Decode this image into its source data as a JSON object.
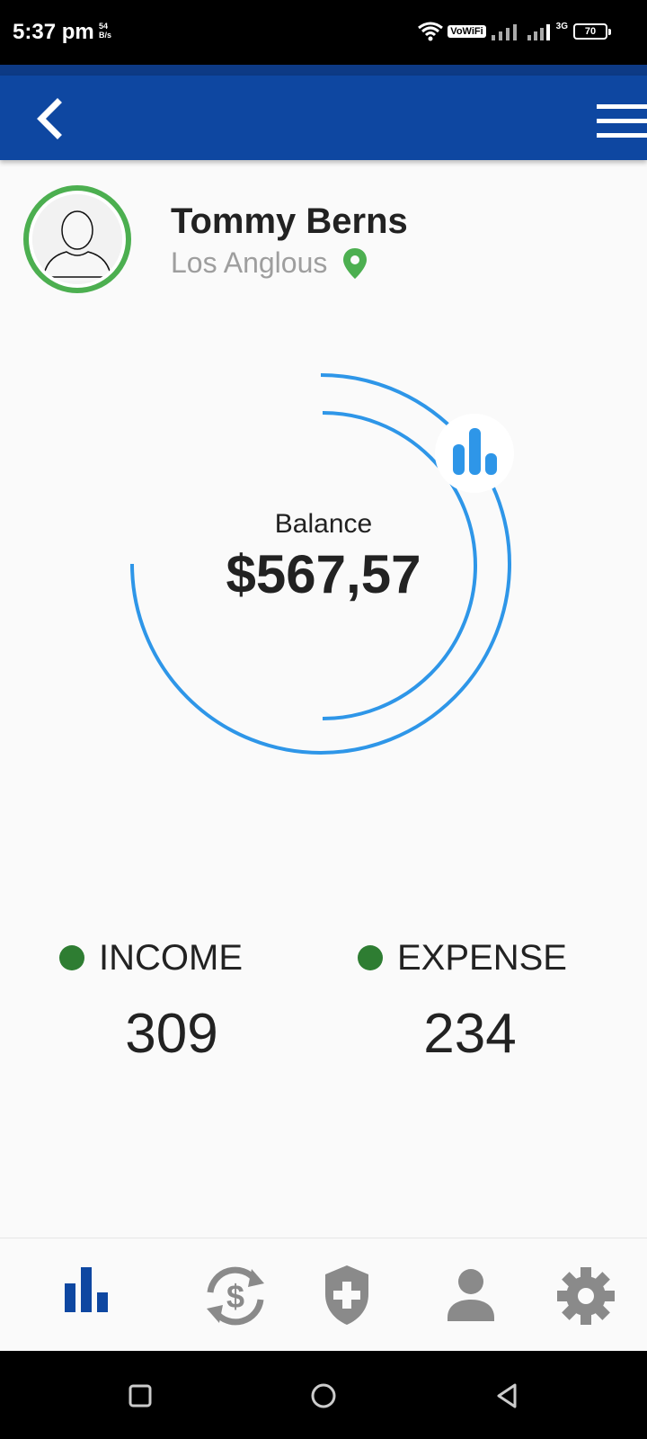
{
  "status_bar": {
    "time": "5:37 pm",
    "speed_value": "54",
    "speed_unit": "B/s",
    "vowifi": "VoWiFi",
    "network": "3G",
    "battery": "70"
  },
  "app_bar": {
    "back_icon": "chevron-left-icon",
    "menu_icon": "hamburger-menu-icon",
    "color": "#0e47a1"
  },
  "profile": {
    "name": "Tommy Berns",
    "location": "Los Anglous",
    "avatar_ring_color": "#4caf50"
  },
  "balance": {
    "label": "Balance",
    "value": "$567,57",
    "ring_color": "#2e96e8"
  },
  "stats": {
    "income": {
      "label": "INCOME",
      "value": "309"
    },
    "expense": {
      "label": "EXPENSE",
      "value": "234"
    },
    "dot_color": "#2e7d32"
  },
  "bottom_nav": {
    "items": [
      {
        "icon": "bar-chart-icon",
        "active": true
      },
      {
        "icon": "currency-exchange-icon",
        "active": false
      },
      {
        "icon": "shield-plus-icon",
        "active": false
      },
      {
        "icon": "person-icon",
        "active": false
      },
      {
        "icon": "gear-icon",
        "active": false
      }
    ],
    "active_color": "#0e47a1",
    "inactive_color": "#8a8a8a"
  }
}
